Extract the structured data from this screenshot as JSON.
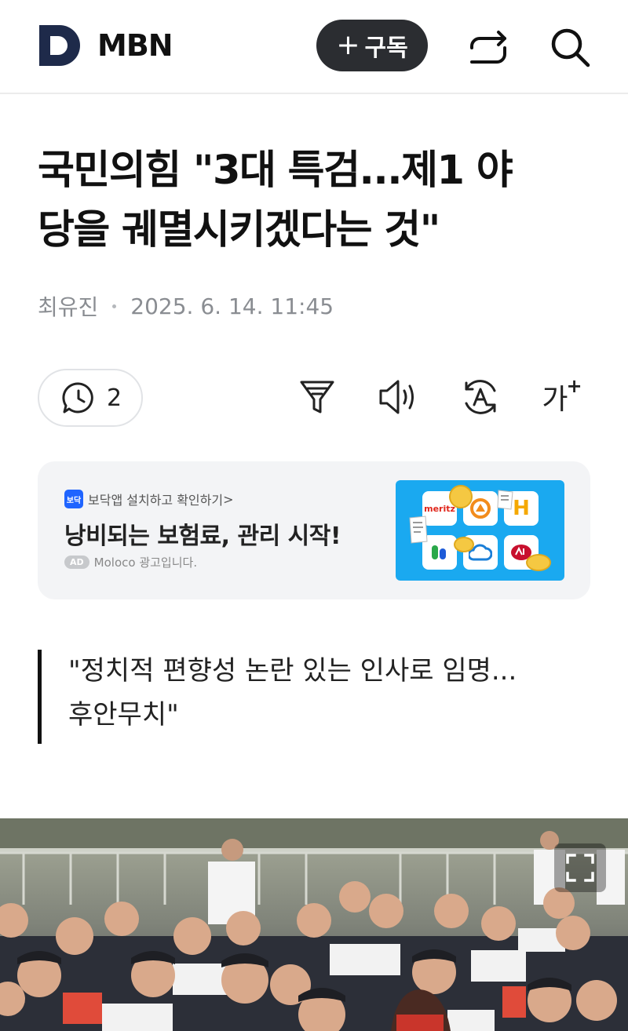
{
  "header": {
    "brand": "MBN",
    "subscribe_plus": "+",
    "subscribe_label": "구독"
  },
  "article": {
    "title_line1": "국민의힘 \"3대 특검...제1 야",
    "title_line2": "당을 궤멸시키겠다는 것\"",
    "author": "최유진",
    "date": "2025. 6. 14. 11:45",
    "quote_line1": "\"정치적 편향성 논란 있는 인사로 임명...",
    "quote_line2": "후안무치\""
  },
  "toolbar": {
    "comment_count": "2",
    "font_label": "가",
    "font_plus": "+"
  },
  "ad": {
    "app_icon_text": "보닥",
    "source": "보닥앱 설치하고 확인하기",
    "source_chevron": ">",
    "headline": "낭비되는 보험료, 관리 시작!",
    "badge": "AD",
    "advertiser": "Moloco 광고입니다.",
    "tile_meritz": "meritz",
    "tile_h": "H"
  },
  "colors": {
    "brand_navy": "#1e2a4a",
    "subscribe_bg": "#2b2d31",
    "ad_bg": "#f3f4f6",
    "ad_image_bg": "#1aa9f0"
  },
  "icons": {
    "share": "share-icon",
    "search": "search-icon",
    "comment": "comment-icon",
    "filter": "summary-filter-icon",
    "audio": "speaker-icon",
    "translate": "translate-icon",
    "expand": "fullscreen-icon"
  }
}
